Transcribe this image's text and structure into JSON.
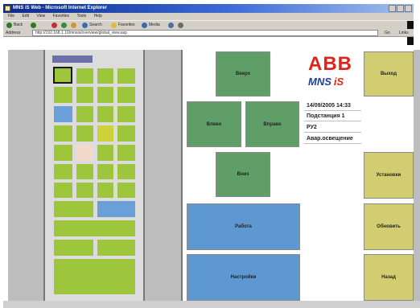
{
  "browser": {
    "title": "MNS iS Web - Microsoft Internet Explorer",
    "menu": [
      "File",
      "Edit",
      "View",
      "Favorites",
      "Tools",
      "Help"
    ],
    "toolbar": {
      "back_label": "Back",
      "search_label": "Search",
      "favorites_label": "Favorites",
      "media_label": "Media"
    },
    "address_label": "Address",
    "address_value": "http://192.168.1.10/mnsis/overview/global_view.asp",
    "go_label": "Go",
    "links_label": "Links"
  },
  "nav": {
    "up": "Вверх",
    "left": "Влево",
    "right": "Вправо",
    "down": "Вниз"
  },
  "modes": {
    "work": "Работа",
    "settings": "Настройки"
  },
  "actions": {
    "exit": "Выход",
    "install": "Установки",
    "refresh": "Обновить",
    "back": "Назад"
  },
  "logo": {
    "abb": "ABB",
    "mns": "MNS",
    "is": "iS"
  },
  "info": {
    "datetime": "14/09/2005 14:33",
    "substation": "Подстанция 1",
    "switchgear": "РУ2",
    "feeder": "Авар.освещение"
  },
  "colors": {
    "nav_button": "#5f9e67",
    "mode_button": "#5e98d0",
    "action_button": "#d3cd72",
    "cell_normal": "#9dc63c",
    "cell_selected_blue": "#6a9fd8",
    "cell_warning": "#cdd23a",
    "cell_inactive": "#f3d9cc",
    "abb_red": "#e2231a"
  }
}
